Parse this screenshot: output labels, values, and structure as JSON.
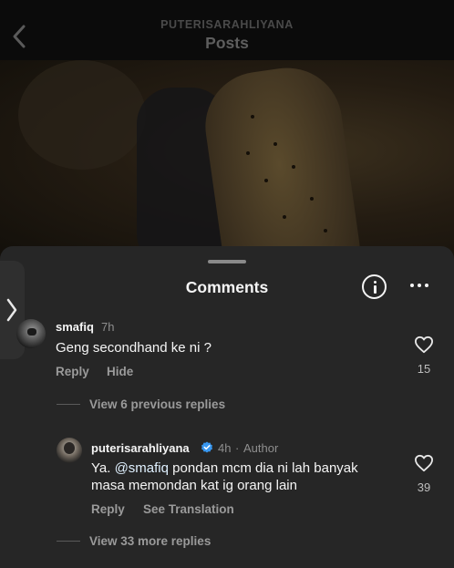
{
  "header": {
    "username": "PUTERISARAHLIYANA",
    "title": "Posts"
  },
  "sheet": {
    "title": "Comments"
  },
  "comments": [
    {
      "username": "smafiq",
      "time": "7h",
      "text": "Geng secondhand ke ni ?",
      "actions": [
        "Reply",
        "Hide"
      ],
      "likes": "15",
      "view_replies": "View 6 previous replies"
    }
  ],
  "reply": {
    "username": "puterisarahliyana",
    "time": "4h",
    "author_sep": "·",
    "author_label": "Author",
    "mention": "@smafiq",
    "text_line1_after_mention": " pondan mcm dia ni lah banyak",
    "text_prefix": "Ya. ",
    "text_line2": "masa memondan kat ig orang lain",
    "actions": [
      "Reply",
      "See Translation"
    ],
    "likes": "39",
    "view_more": "View 33 more replies"
  },
  "colors": {
    "sheet_bg": "#262626",
    "verified": "#3897f0"
  }
}
